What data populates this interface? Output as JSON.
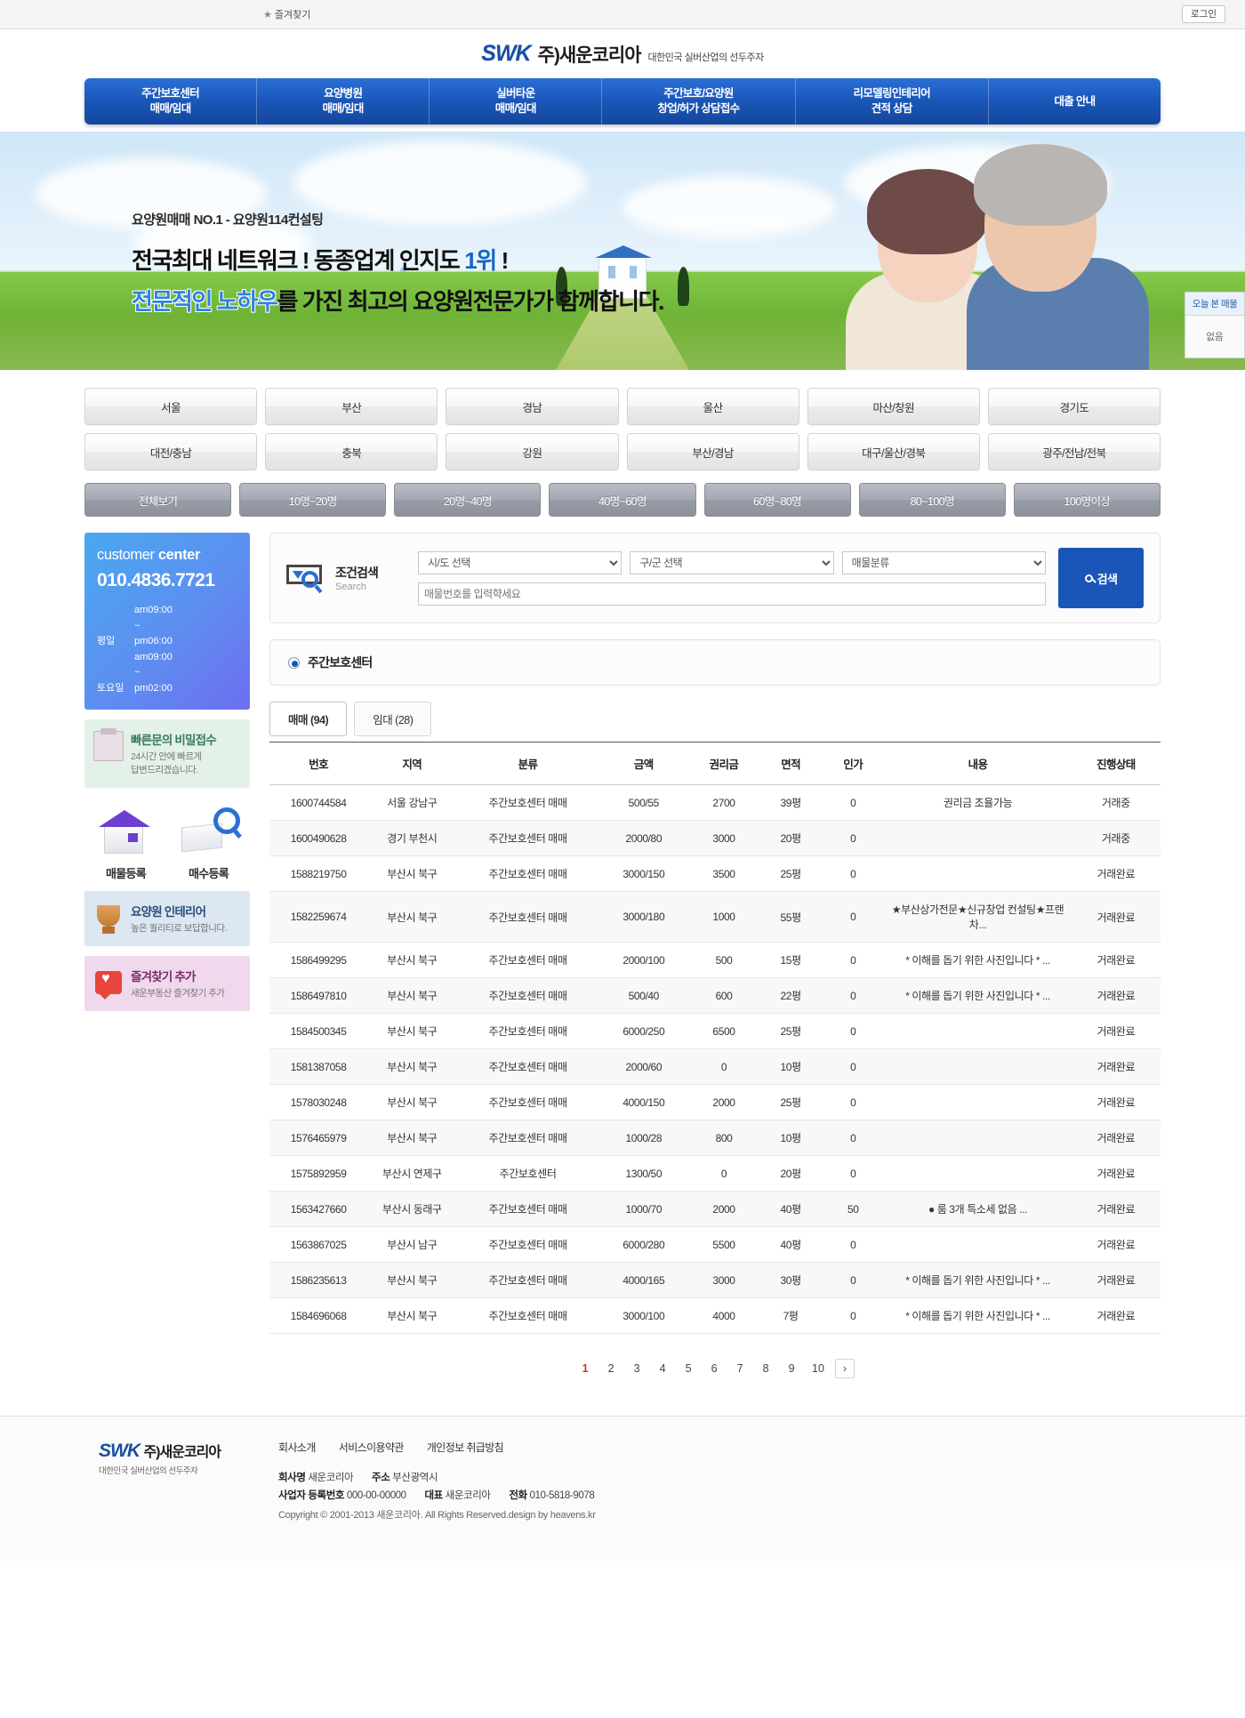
{
  "topbar": {
    "favorite_label": "즐겨찾기",
    "star_icon": "★",
    "login_label": "로그인"
  },
  "brand": {
    "mark": "SWK",
    "name": "주)새운코리아",
    "tagline": "대한민국 실버산업의 선두주자"
  },
  "nav": {
    "items": [
      {
        "line1": "주간보호센터",
        "line2": "매매/임대"
      },
      {
        "line1": "요양병원",
        "line2": "매매/임대"
      },
      {
        "line1": "실버타운",
        "line2": "매매/임대"
      },
      {
        "line1": "주간보호/요양원",
        "line2": "창업/허가 상담접수"
      },
      {
        "line1": "리모델링인테리어",
        "line2": "견적 상담"
      },
      {
        "line1": "대출 안내",
        "line2": ""
      }
    ]
  },
  "hero": {
    "eyebrow": "요양원매매 NO.1 - 요양원114컨설팅",
    "line1_a": "전국최대 네트워크 ! 동종업계 인지도 ",
    "line1_hl": "1위",
    "line1_b": " !",
    "line2_hl": "전문적인 노하우",
    "line2_b": "를 가진 최고의 요양원전문가가 함께합니다."
  },
  "recent_box": {
    "title": "오늘 본 매물",
    "empty": "없음"
  },
  "regions": [
    "서울",
    "부산",
    "경남",
    "울산",
    "마산/창원",
    "경기도",
    "대전/충남",
    "충북",
    "강원",
    "부산/경남",
    "대구/울산/경북",
    "광주/전남/전북"
  ],
  "capacities": [
    "전체보기",
    "10명~20명",
    "20명~40명",
    "40명~60명",
    "60명~80명",
    "80~100명",
    "100명이상"
  ],
  "customer_center": {
    "title_light": "customer ",
    "title_bold": "center",
    "phone": "010.4836.7721",
    "weekday_label": "평일",
    "weekday_hours": "am09:00 ~ pm06:00",
    "saturday_label": "토요일",
    "saturday_hours": "am09:00 ~ pm02:00"
  },
  "side_banners": [
    {
      "icon": "clipboard-icon",
      "title": "빠른문의 비밀접수",
      "desc_line1": "24시간 안에 빠르게",
      "desc_line2": "답변드리겠습니다."
    },
    {
      "icon": "trophy-icon",
      "title": "요양원 인테리어",
      "desc_line1": "높은 퀄리티로 보답합니다.",
      "desc_line2": ""
    },
    {
      "icon": "heart-icon",
      "title": "즐겨찾기 추가",
      "desc_line1": "새운부동산 즐겨찾기 추가",
      "desc_line2": ""
    }
  ],
  "register_pair": [
    {
      "icon": "house-icon",
      "label": "매물등록"
    },
    {
      "icon": "book-search-icon",
      "label": "매수등록"
    }
  ],
  "search": {
    "title_kr": "조건검색",
    "title_en": "Search",
    "sido_selected": "시/도 선택",
    "gugun_selected": "구/군 선택",
    "type_selected": "매물분류",
    "number_placeholder": "매물번호를 입력햑세요",
    "number_value": "",
    "button_label": "검색",
    "button_icon": "search-icon"
  },
  "category": {
    "radio_icon": "radio-selected-icon",
    "label": "주간보호센터"
  },
  "tabs": [
    {
      "label": "매매 (94)",
      "active": true
    },
    {
      "label": "임대 (28)",
      "active": false
    }
  ],
  "table": {
    "headers": [
      "번호",
      "지역",
      "분류",
      "금액",
      "권리금",
      "면적",
      "인가",
      "내용",
      "진행상태"
    ],
    "rows": [
      {
        "no": "1600744584",
        "area": "서울 강남구",
        "kind": "주간보호센터 매매",
        "price": "500/55",
        "key": "2700",
        "size": "39평",
        "cert": "0",
        "desc": "권리금 조율가능",
        "state": "거래중"
      },
      {
        "no": "1600490628",
        "area": "경기 부천시",
        "kind": "주간보호센터 매매",
        "price": "2000/80",
        "key": "3000",
        "size": "20평",
        "cert": "0",
        "desc": "",
        "state": "거래중"
      },
      {
        "no": "1588219750",
        "area": "부산시 북구",
        "kind": "주간보호센터 매매",
        "price": "3000/150",
        "key": "3500",
        "size": "25평",
        "cert": "0",
        "desc": "",
        "state": "거래완료"
      },
      {
        "no": "1582259674",
        "area": "부산시 북구",
        "kind": "주간보호센터 매매",
        "price": "3000/180",
        "key": "1000",
        "size": "55평",
        "cert": "0",
        "desc": "★부산상가전문★신규창업 컨설팅★프랜차...",
        "state": "거래완료"
      },
      {
        "no": "1586499295",
        "area": "부산시 북구",
        "kind": "주간보호센터 매매",
        "price": "2000/100",
        "key": "500",
        "size": "15평",
        "cert": "0",
        "desc": "* 이해를 돕기 위한 사진입니다 * ...",
        "state": "거래완료"
      },
      {
        "no": "1586497810",
        "area": "부산시 북구",
        "kind": "주간보호센터 매매",
        "price": "500/40",
        "key": "600",
        "size": "22평",
        "cert": "0",
        "desc": "* 이해를 돕기 위한 사진입니다 * ...",
        "state": "거래완료"
      },
      {
        "no": "1584500345",
        "area": "부산시 북구",
        "kind": "주간보호센터 매매",
        "price": "6000/250",
        "key": "6500",
        "size": "25평",
        "cert": "0",
        "desc": "",
        "state": "거래완료"
      },
      {
        "no": "1581387058",
        "area": "부산시 북구",
        "kind": "주간보호센터 매매",
        "price": "2000/60",
        "key": "0",
        "size": "10평",
        "cert": "0",
        "desc": "",
        "state": "거래완료"
      },
      {
        "no": "1578030248",
        "area": "부산시 북구",
        "kind": "주간보호센터 매매",
        "price": "4000/150",
        "key": "2000",
        "size": "25평",
        "cert": "0",
        "desc": "",
        "state": "거래완료"
      },
      {
        "no": "1576465979",
        "area": "부산시 북구",
        "kind": "주간보호센터 매매",
        "price": "1000/28",
        "key": "800",
        "size": "10평",
        "cert": "0",
        "desc": "",
        "state": "거래완료"
      },
      {
        "no": "1575892959",
        "area": "부산시 연제구",
        "kind": "주간보호센터",
        "price": "1300/50",
        "key": "0",
        "size": "20평",
        "cert": "0",
        "desc": "",
        "state": "거래완료"
      },
      {
        "no": "1563427660",
        "area": "부산시 동래구",
        "kind": "주간보호센터 매매",
        "price": "1000/70",
        "key": "2000",
        "size": "40평",
        "cert": "50",
        "desc": "● 룸 3개 특소세 없음  ...",
        "state": "거래완료"
      },
      {
        "no": "1563867025",
        "area": "부산시 남구",
        "kind": "주간보호센터 매매",
        "price": "6000/280",
        "key": "5500",
        "size": "40평",
        "cert": "0",
        "desc": "",
        "state": "거래완료"
      },
      {
        "no": "1586235613",
        "area": "부산시 북구",
        "kind": "주간보호센터 매매",
        "price": "4000/165",
        "key": "3000",
        "size": "30평",
        "cert": "0",
        "desc": "* 이해를 돕기 위한 사진입니다 * ...",
        "state": "거래완료"
      },
      {
        "no": "1584696068",
        "area": "부산시 북구",
        "kind": "주간보호센터 매매",
        "price": "3000/100",
        "key": "4000",
        "size": "7평",
        "cert": "0",
        "desc": "* 이해를 돕기 위한 사진입니다 * ...",
        "state": "거래완료"
      }
    ]
  },
  "pagination": {
    "pages": [
      "1",
      "2",
      "3",
      "4",
      "5",
      "6",
      "7",
      "8",
      "9",
      "10"
    ],
    "current": "1",
    "next_label": "›"
  },
  "footer": {
    "links": [
      "회사소개",
      "서비스이용약관",
      "개인정보 취급방침"
    ],
    "company_label": "회사명",
    "company_value": "새운코리아",
    "address_label": "주소",
    "address_value": "부산광역시",
    "biz_label": "사업자 등록번호",
    "biz_value": "000-00-00000",
    "ceo_label": "대표",
    "ceo_value": "새운코리아",
    "tel_label": "전화",
    "tel_value": "010-5818-9078",
    "copyright": "Copyright © 2001-2013 새운코리아. All Rights Reserved.design by heavens.kr"
  }
}
